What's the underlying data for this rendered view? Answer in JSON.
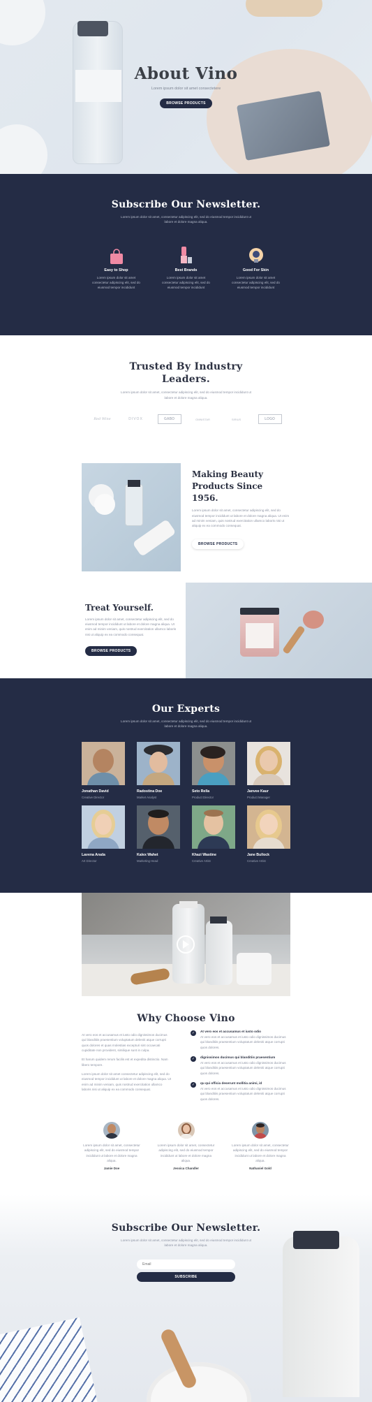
{
  "hero": {
    "title": "About Vino",
    "subtitle": "Lorem ipsum dolor sit amet consectetere",
    "button": "BROWSE PRODUCTS"
  },
  "newsletter_top": {
    "title": "Subscribe Our Newsletter.",
    "text": "Lorem ipsum dolor sit amet, consectetur adipiscing elit, sed do eiusmod tempor incididunt ut labore et dolore magna aliqua.",
    "features": [
      {
        "icon": "shopping-bag-icon",
        "title": "Easy to Shop",
        "text": "Lorem ipsum dolor sit amet consectetur adipiscing elit, sed do eiusmod tempor incididunt"
      },
      {
        "icon": "lipstick-icon",
        "title": "Best Brands",
        "text": "Lorem ipsum dolor sit amet consectetur adipiscing elit, sed do eiusmod tempor incididunt"
      },
      {
        "icon": "bulb-icon",
        "title": "Good For Skin",
        "text": "Lorem ipsum dolor sit amet consectetur adipiscing elit, sed do eiusmod tempor incididunt"
      }
    ]
  },
  "trusted": {
    "title_line1": "Trusted By Industry",
    "title_line2": "Leaders.",
    "text": "Lorem ipsum dolor sit amet, consectetur adipiscing elit, sed do eiusmod tempor incididunt ut labore et dolore magna aliqua.",
    "logos": [
      "Red Wine",
      "DIVOX",
      "GABO",
      "OMNISTAR",
      "SIRIUS",
      "LOGO"
    ]
  },
  "making": {
    "title_line1": "Making Beauty",
    "title_line2": "Products Since 1956.",
    "text": "Lorem ipsum dolor sit amet, consectetur adipiscing elit, sed do eiusmod tempor incididunt ut labore et dolore magna aliqua. Ut enim ad minim veniam, quis nostrud exercitation ullamco laboris nisi ut aliquip ex ea commodo consequat.",
    "button": "BROWSE PRODUCTS"
  },
  "treat": {
    "title": "Treat Yourself.",
    "text": "Lorem ipsum dolor sit amet, consectetur adipiscing elit, sed do eiusmod tempor incididunt ut labore et dolore magna aliqua. Ut enim ad minim veniam, quis nostrud exercitation ullamco laboris nisi ut aliquip ex ea commodo consequat.",
    "button": "BROWSE PRODUCTS"
  },
  "experts": {
    "title": "Our Experts",
    "text": "Lorem ipsum dolor sit amet, consectetur adipiscing elit, sed do eiusmod tempor incididunt ut labore et dolore magna aliqua.",
    "people": [
      {
        "name": "Jonathan David",
        "role": "Creative Director"
      },
      {
        "name": "Radostina Doe",
        "role": "Market Analyst"
      },
      {
        "name": "Seto Rella",
        "role": "Product Director"
      },
      {
        "name": "Janvee Kaur",
        "role": "Product Manager"
      },
      {
        "name": "Lavena Arada",
        "role": "Art Director"
      },
      {
        "name": "Kalex Wahet",
        "role": "Marketing Head"
      },
      {
        "name": "Khazi Wastine",
        "role": "Creative Artist"
      },
      {
        "name": "Jane Bullock",
        "role": "Creative Artist"
      }
    ]
  },
  "why": {
    "title": "Why Choose Vino",
    "paragraphs": [
      "At vero eos et accusamus et iusto odio dignissimos ducimus qui blanditiis praesentium voluptatum deleniti atque corrupti quos dolores et quas molestias excepturi sint occaecati cupiditate non provident, similique sunt in culpa.",
      "Et harum quidem rerum facilis est et expedita distinctio. Nam libero tempore.",
      "Lorem ipsum dolor sit amet consectetur adipiscing elit, sed do eiusmod tempor incididunt ut labore et dolore magna aliqua. Ut enim ad minim veniam, quis nostrud exercitation ullamco laboris nisi ut aliquip ex ea commodo consequat."
    ],
    "checks": [
      {
        "title": "At vero eos et accusamus et iusto odio",
        "text": "At vero eos et accusamus et iusto odio dignissimos ducimus qui blanditiis praesentium voluptatum deleniti atque corrupti quos dolores."
      },
      {
        "title": "dignissimos ducimus qui blanditiis praesentium",
        "text": "At vero eos et accusamus et iusto odio dignissimos ducimus qui blanditiis praesentium voluptatum deleniti atque corrupti quos dolores."
      },
      {
        "title": "qu qui officia deserunt mollitia animi, id",
        "text": "At vero eos et accusamus et iusto odio dignissimos ducimus qui blanditiis praesentium voluptatum deleniti atque corrupti quos dolores."
      }
    ],
    "testimonials": [
      {
        "text": "Lorem ipsum dolor sit amet, consectetur adipiscing elit, sed do eiusmod tempor incididunt ut labore et dolore magna aliqua.",
        "name": "Jamie Doe"
      },
      {
        "text": "Lorem ipsum dolor sit amet, consectetur adipiscing elit, sed do eiusmod tempor incididunt ut labore et dolore magna aliqua.",
        "name": "Jessica Chandler"
      },
      {
        "text": "Lorem ipsum dolor sit amet, consectetur adipiscing elit, sed do eiusmod tempor incididunt ut labore et dolore magna aliqua.",
        "name": "Nathaniel Gold"
      }
    ]
  },
  "newsletter_bottom": {
    "title": "Subscribe Our Newsletter.",
    "text": "Lorem ipsum dolor sit amet, consectetur adipiscing elit, sed do eiusmod tempor incididunt ut labore et dolore magna aliqua.",
    "email_placeholder": "Email",
    "button": "SUBSCRIBE"
  },
  "colors": {
    "navy": "#242c45",
    "accent_pink": "#f08aa4",
    "text_muted": "#8d93a3"
  }
}
